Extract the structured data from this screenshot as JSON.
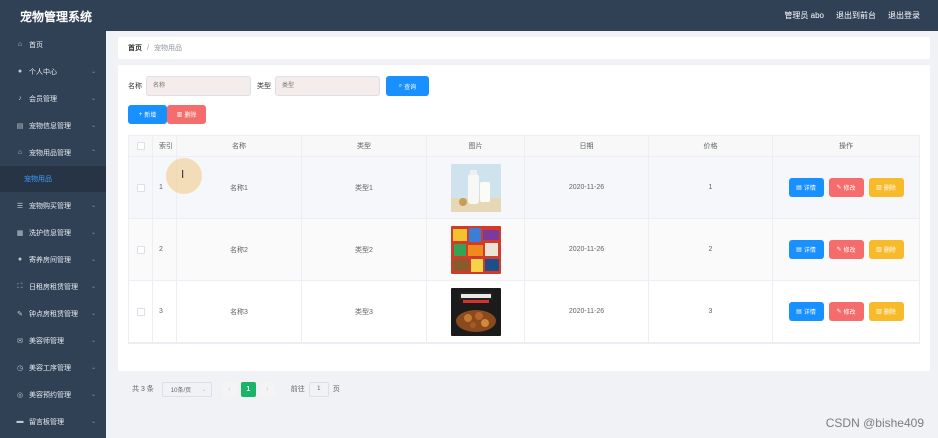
{
  "app": {
    "title": "宠物管理系统"
  },
  "header": {
    "user_label": "管理员 abo",
    "front_label": "退出到前台",
    "logout_label": "退出登录"
  },
  "sidebar": {
    "items": [
      {
        "label": "首页",
        "icon": "home-icon",
        "expandable": false
      },
      {
        "label": "个人中心",
        "icon": "user-icon",
        "expandable": true
      },
      {
        "label": "会员管理",
        "icon": "microphone-icon",
        "expandable": true
      },
      {
        "label": "宠物信息管理",
        "icon": "list-icon",
        "expandable": true
      },
      {
        "label": "宠物用品管理",
        "icon": "bank-icon",
        "expandable": true,
        "expanded": true
      },
      {
        "label": "宠物购买管理",
        "icon": "menu-icon",
        "expandable": true
      },
      {
        "label": "洗护信息管理",
        "icon": "grid-icon",
        "expandable": true
      },
      {
        "label": "寄养房间管理",
        "icon": "person-icon",
        "expandable": true
      },
      {
        "label": "日租房租赁管理",
        "icon": "fullscreen-icon",
        "expandable": true
      },
      {
        "label": "钟点房租赁管理",
        "icon": "pen-icon",
        "expandable": true
      },
      {
        "label": "美容师管理",
        "icon": "mail-icon",
        "expandable": true
      },
      {
        "label": "美容工序管理",
        "icon": "clock-icon",
        "expandable": true
      },
      {
        "label": "美容预约管理",
        "icon": "circle-icon",
        "expandable": true
      },
      {
        "label": "留言板管理",
        "icon": "board-icon",
        "expandable": true
      }
    ],
    "subitem": "宠物用品"
  },
  "breadcrumb": {
    "home": "首页",
    "separator": "/",
    "current": "宠物用品"
  },
  "search": {
    "name_label": "名称",
    "name_placeholder": "名称",
    "type_label": "类型",
    "type_placeholder": "类型",
    "button_label": "查询"
  },
  "actions": {
    "add_label": "新增",
    "delete_label": "删除"
  },
  "table": {
    "headers": [
      "索引",
      "名称",
      "类型",
      "图片",
      "日期",
      "价格",
      "操作"
    ],
    "rows": [
      {
        "index": "1",
        "name": "名称1",
        "type": "类型1",
        "image": "milk-bottle-photo",
        "date": "2020-11-26",
        "price": "1"
      },
      {
        "index": "2",
        "name": "名称2",
        "type": "类型2",
        "image": "snacks-collage-photo",
        "date": "2020-11-26",
        "price": "2"
      },
      {
        "index": "3",
        "name": "名称3",
        "type": "类型3",
        "image": "fried-food-poster",
        "date": "2020-11-26",
        "price": "3"
      }
    ],
    "row_actions": {
      "detail": "详情",
      "edit": "修改",
      "delete": "删除"
    }
  },
  "pagination": {
    "total_text": "共 3 条",
    "page_size": "10条/页",
    "current_page": "1",
    "goto_label": "前往",
    "goto_value": "1",
    "page_suffix": "页"
  },
  "watermark": "CSDN @bishe409",
  "colors": {
    "primary": "#1890ff",
    "danger": "#f56c6c",
    "warning": "#f7ba2a",
    "success": "#18b566",
    "sidebar": "#304156"
  }
}
